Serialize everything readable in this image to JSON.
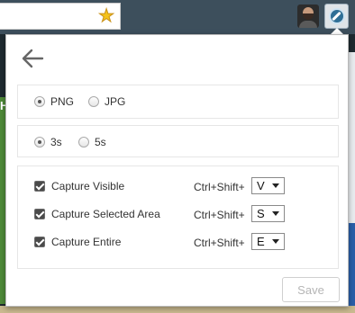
{
  "format": {
    "options": [
      "PNG",
      "JPG"
    ],
    "selected": "PNG"
  },
  "delay": {
    "options": [
      "3s",
      "5s"
    ],
    "selected": "3s"
  },
  "captures": [
    {
      "label": "Capture Visible",
      "checked": true,
      "shortcut": "Ctrl+Shift+",
      "key": "V"
    },
    {
      "label": "Capture Selected Area",
      "checked": true,
      "shortcut": "Ctrl+Shift+",
      "key": "S"
    },
    {
      "label": "Capture Entire",
      "checked": true,
      "shortcut": "Ctrl+Shift+",
      "key": "E"
    }
  ],
  "save_label": "Save",
  "bg_letter": "H",
  "icons": {
    "back": "back-arrow-icon",
    "bookmark": "star-icon",
    "extension": "compass-icon"
  },
  "colors": {
    "star": "#f4c21b",
    "extension": "#2f6f96",
    "save_disabled_text": "#b5b5b5"
  }
}
